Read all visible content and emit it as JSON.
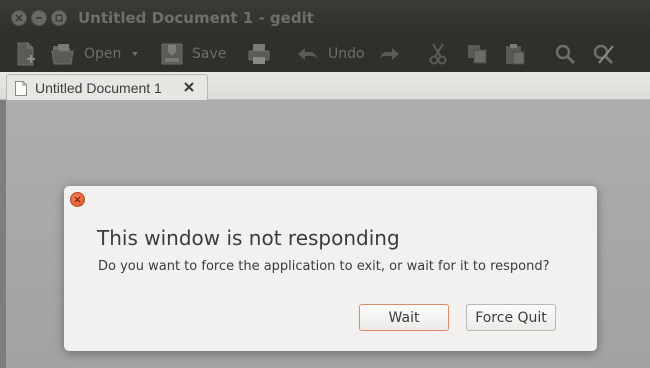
{
  "window": {
    "title": "Untitled Document 1 - gedit",
    "controls": [
      "close-icon",
      "minimize-icon",
      "maximize-icon"
    ]
  },
  "toolbar": {
    "items": [
      {
        "id": "new",
        "icon": "new-document-icon"
      },
      {
        "id": "open",
        "icon": "open-folder-icon",
        "label": "Open"
      },
      {
        "id": "open-menu",
        "icon": "chevron-down-icon"
      },
      {
        "id": "save",
        "icon": "save-icon",
        "label": "Save"
      },
      {
        "id": "print",
        "icon": "print-icon"
      },
      {
        "id": "undo",
        "icon": "undo-icon",
        "label": "Undo"
      },
      {
        "id": "redo",
        "icon": "redo-icon"
      },
      {
        "id": "cut",
        "icon": "cut-icon"
      },
      {
        "id": "copy",
        "icon": "copy-icon"
      },
      {
        "id": "paste",
        "icon": "paste-icon"
      },
      {
        "id": "find",
        "icon": "search-icon"
      },
      {
        "id": "replace",
        "icon": "find-replace-icon"
      }
    ]
  },
  "tabs": [
    {
      "label": "Untitled Document 1",
      "icon": "document-icon",
      "close_icon": "close-icon"
    }
  ],
  "dialog": {
    "title": "This window is not responding",
    "message": "Do you want to force the application to exit, or wait for it to respond?",
    "buttons": {
      "wait": "Wait",
      "force_quit": "Force Quit"
    },
    "close_icon": "close-icon"
  },
  "colors": {
    "titlebar": "#3c3b37",
    "dialog_close": "#dc4e22",
    "default_button_border": "#e0886a"
  }
}
